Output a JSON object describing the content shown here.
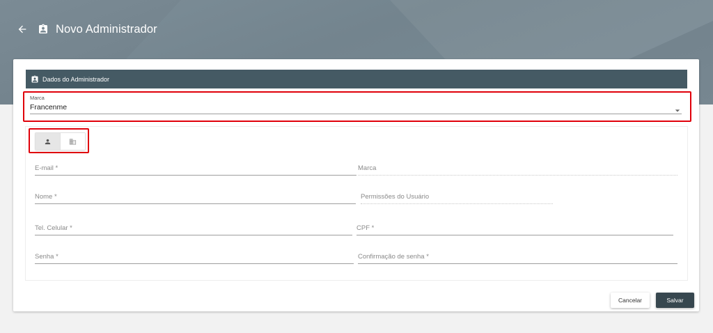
{
  "header": {
    "title": "Novo Administrador",
    "back_icon": "arrow-left-icon",
    "title_icon": "contact-badge-icon",
    "background_color": "#78898f"
  },
  "section": {
    "title": "Dados do Administrador",
    "icon": "contact-badge-icon",
    "background_color": "#455a64"
  },
  "brand_select": {
    "label": "Marca",
    "value": "Francenme"
  },
  "type_toggle": {
    "options": [
      {
        "icon": "person-icon",
        "selected": true
      },
      {
        "icon": "business-icon",
        "selected": false
      }
    ]
  },
  "form": {
    "email_placeholder": "E-mail *",
    "marca_placeholder": "Marca",
    "nome_placeholder": "Nome *",
    "permissoes_placeholder": "Permissões do Usuário",
    "celular_placeholder": "Tel. Celular *",
    "cpf_placeholder": "CPF *",
    "senha_placeholder": "Senha *",
    "confirmacao_placeholder": "Confirmação de senha *"
  },
  "actions": {
    "cancel_label": "Cancelar",
    "save_label": "Salvar",
    "save_color": "#37474f"
  },
  "highlight_color": "#e0000a"
}
